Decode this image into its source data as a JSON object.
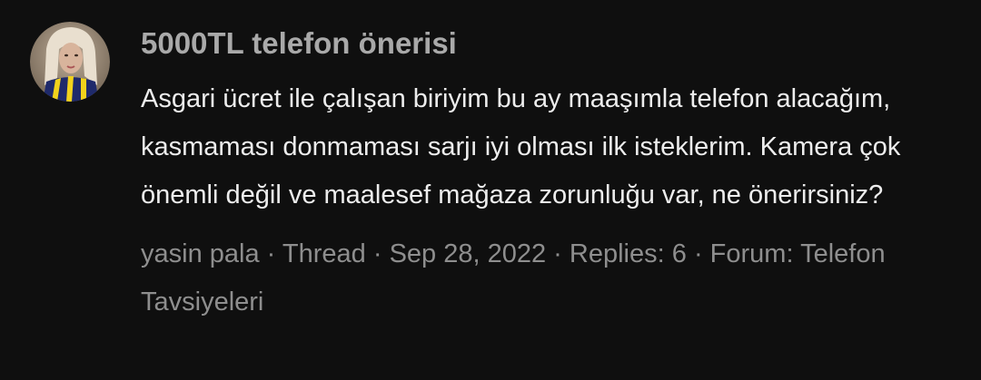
{
  "thread": {
    "title": "5000TL telefon önerisi",
    "snippet": "Asgari ücret ile çalışan biriyim bu ay maaşımla telefon alacağım, kasmaması donmaması sarjı iyi olması ilk isteklerim. Kamera çok önemli değil ve maalesef mağaza zorunluğu var, ne önerirsiniz?",
    "author": "yasin pala",
    "type": "Thread",
    "date": "Sep 28, 2022",
    "replies_label": "Replies: 6",
    "forum_label": "Forum:",
    "forum_name": "Telefon Tavsiyeleri",
    "separator": "·"
  }
}
